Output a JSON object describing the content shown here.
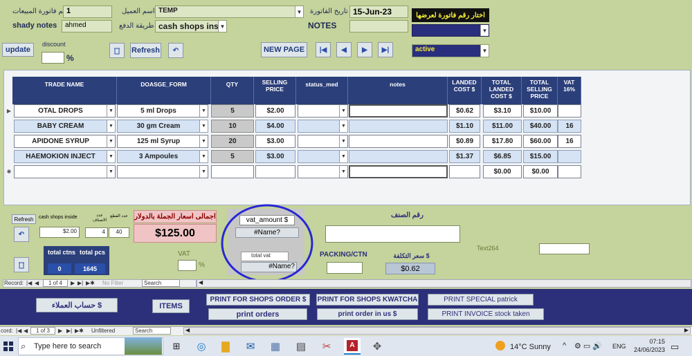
{
  "header": {
    "invoice_no_label": "رقم فاتورة المبيعات",
    "invoice_no_value": "1",
    "customer_label": "اسم العميل",
    "customer_value": "TEMP",
    "invoice_date_label": "تاريخ الفاتورة",
    "invoice_date_value": "15-Jun-23",
    "choose_invoice_label": "اختار رقم فاتورة لعرضها",
    "shady_notes_label": "shady notes",
    "shady_notes_value": "ahmed",
    "payment_method_label": "طريقة الدفع",
    "payment_method_value": "cash shops ins",
    "notes_label": "NOTES",
    "notes_value": "",
    "status_value": "active",
    "discount_label": "discount",
    "percent": "%"
  },
  "toolbar": {
    "update": "update",
    "refresh": "Refresh",
    "new_page": "NEW PAGE"
  },
  "grid": {
    "columns": [
      "TRADE NAME",
      "DOASGE_FORM",
      "QTY",
      "SELLING PRICE",
      "status_med",
      "notes",
      "LANDED COST $",
      "TOTAL LANDED COST $",
      "TOTAL SELLING PRICE",
      "VAT 16%"
    ],
    "rows": [
      {
        "trade": "OTAL DROPS",
        "form": "5 ml Drops",
        "qty": "5",
        "price": "$2.00",
        "status": "",
        "notes": "",
        "landed": "$0.62",
        "total_landed": "$3.10",
        "total_selling": "$10.00",
        "vat": ""
      },
      {
        "trade": "BABY CREAM",
        "form": "30 gm Cream",
        "qty": "10",
        "price": "$4.00",
        "status": "",
        "notes": "",
        "landed": "$1.10",
        "total_landed": "$11.00",
        "total_selling": "$40.00",
        "vat": "16"
      },
      {
        "trade": "APIDONE SYRUP",
        "form": "125 ml Syrup",
        "qty": "20",
        "price": "$3.00",
        "status": "",
        "notes": "",
        "landed": "$0.89",
        "total_landed": "$17.80",
        "total_selling": "$60.00",
        "vat": "16"
      },
      {
        "trade": "HAEMOKION INJECT",
        "form": "3 Ampoules",
        "qty": "5",
        "price": "$3.00",
        "status": "",
        "notes": "",
        "landed": "$1.37",
        "total_landed": "$6.85",
        "total_selling": "$15.00",
        "vat": ""
      },
      {
        "trade": "",
        "form": "",
        "qty": "",
        "price": "",
        "status": "",
        "notes": "",
        "landed": "",
        "total_landed": "$0.00",
        "total_selling": "$0.00",
        "vat": ""
      }
    ]
  },
  "footer": {
    "refresh": "Refresh",
    "cash_shops_inside": "cash shops inside",
    "pieces_count_label": "عدد القطع",
    "items_count_label": "عدد الاصناف",
    "price_value": "$2.00",
    "items_value": "4",
    "pieces_value": "40",
    "total_wholesale_label": "اجمالى اسعار الجملة بالدولار",
    "total_wholesale_value": "$125.00",
    "total_ctns_label": "total ctns",
    "total_pcs_label": "total pcs",
    "total_ctns_value": "0",
    "total_pcs_value": "1645",
    "vat_label": "VAT",
    "vat_percent": "%",
    "vat_amount_label": "vat_amount $",
    "vat_amount_value": "#Name?",
    "total_vat_label": "total vat",
    "total_vat_value": "#Name?",
    "item_no_label": "رقم الصنف",
    "packing_label": "PACKING/CTN",
    "cost_price_label": "سعر التكلفة $",
    "cost_price_value": "$0.62",
    "text264_label": "Text264",
    "record_nav": {
      "label": "Record:",
      "current": "1 of 4",
      "filter": "No Filter",
      "search": "Search"
    }
  },
  "bottom_buttons": {
    "customers_account": "حساب العملاء $",
    "items": "ITEMS",
    "print_shops_order": "PRINT FOR SHOPS ORDER $",
    "print_shops_kwatcha": "PRINT FOR SHOPS KWATCHA",
    "print_special": "PRINT SPECIAL patrick",
    "print_orders": "print orders",
    "print_order_us": "print order in us $",
    "print_invoice_stock": "PRINT INVOICE stock taken"
  },
  "outer_nav": {
    "label": "cord:",
    "current": "1 of 3",
    "filter": "Unfiltered",
    "search": "Search"
  },
  "taskbar": {
    "search_placeholder": "Type here to search",
    "weather": "14°C  Sunny",
    "language": "ENG",
    "time": "07:15",
    "date": "24/06/2023"
  }
}
